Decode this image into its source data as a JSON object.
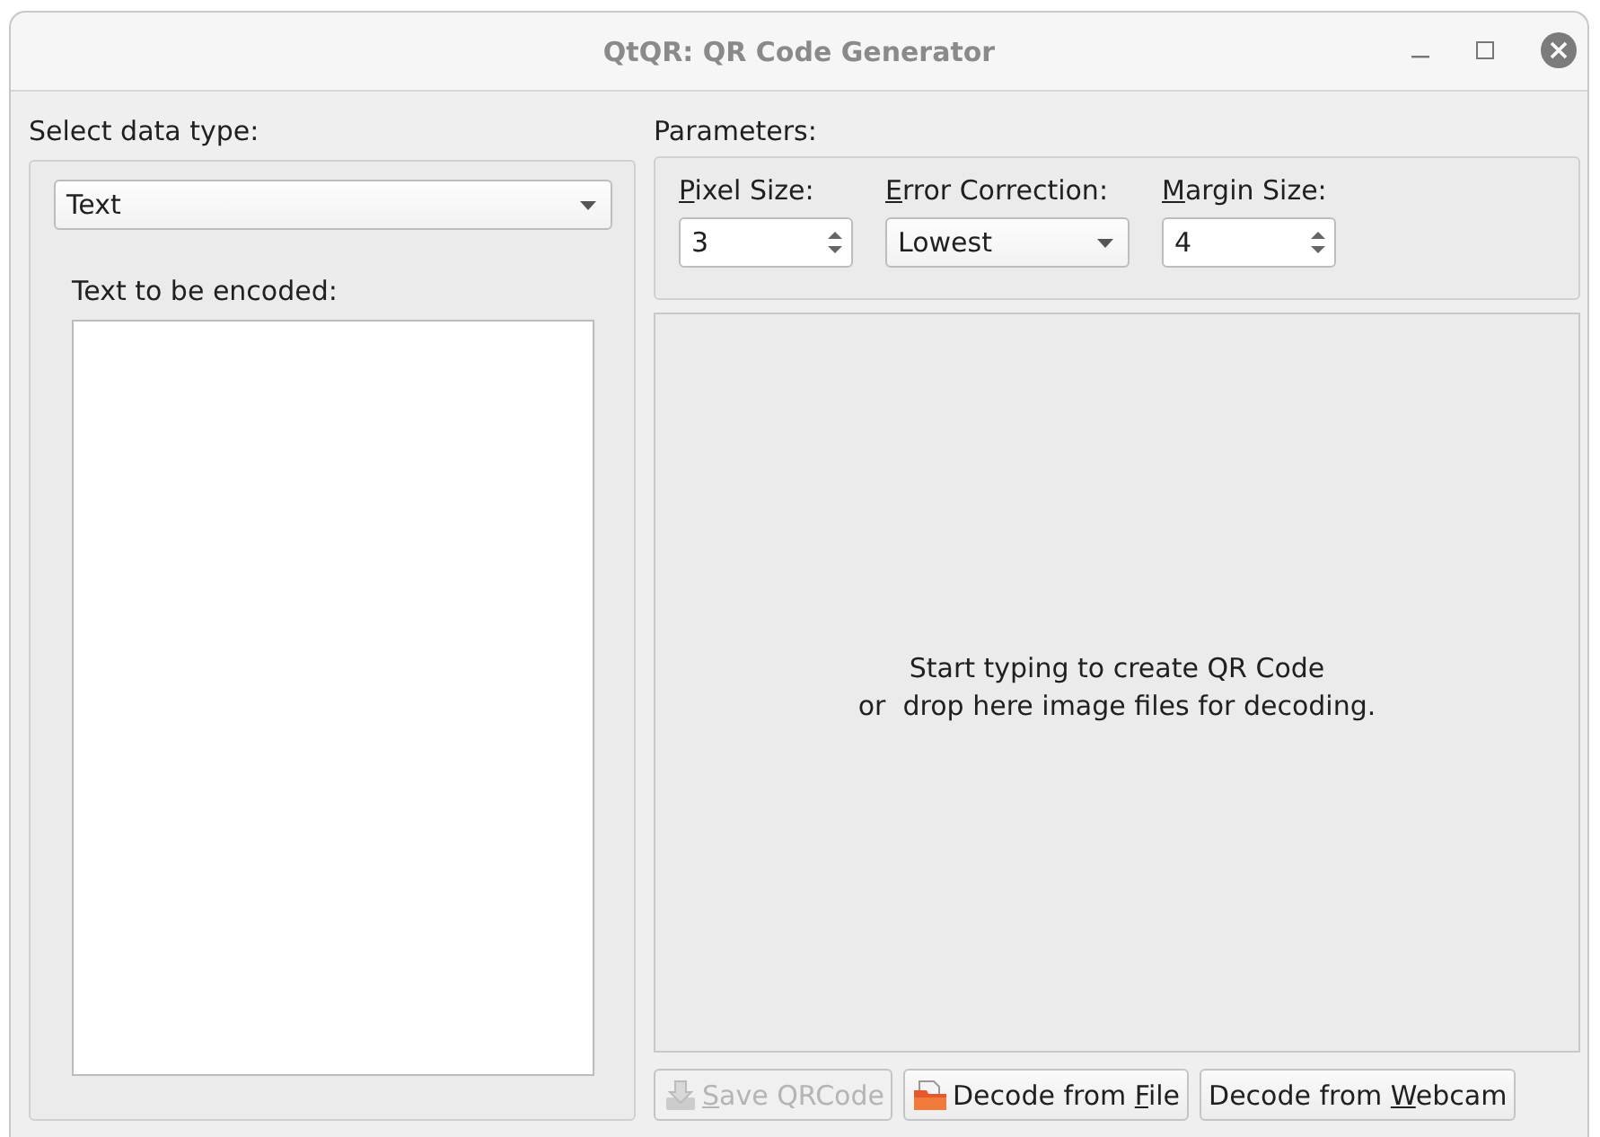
{
  "window": {
    "title": "QtQR: QR Code Generator"
  },
  "data_type": {
    "label": "Select data type:",
    "value": "Text",
    "field_label": "Text to be encoded:"
  },
  "parameters": {
    "label": "Parameters:",
    "fields": [
      {
        "kind": "spin",
        "label": {
          "key": "P",
          "after": "ixel Size:"
        },
        "value": "3"
      },
      {
        "kind": "combo",
        "label": {
          "key": "E",
          "after": "rror Correction:"
        },
        "value": "Lowest"
      },
      {
        "kind": "spin",
        "label": {
          "key": "M",
          "after": "argin Size:"
        },
        "value": "4"
      }
    ]
  },
  "preview": {
    "lines": [
      "Start typing to create QR Code",
      "or  drop here image files for decoding."
    ]
  },
  "buttons": [
    {
      "kind": "save",
      "label": {
        "key": "S",
        "after": "ave QRCode"
      },
      "disabled": true
    },
    {
      "kind": "open",
      "label": {
        "before": "Decode from ",
        "key": "F",
        "after": "ile"
      },
      "disabled": false
    },
    {
      "kind": "plain",
      "label": {
        "before": "Decode from ",
        "key": "W",
        "after": "ebcam"
      },
      "disabled": false
    }
  ]
}
